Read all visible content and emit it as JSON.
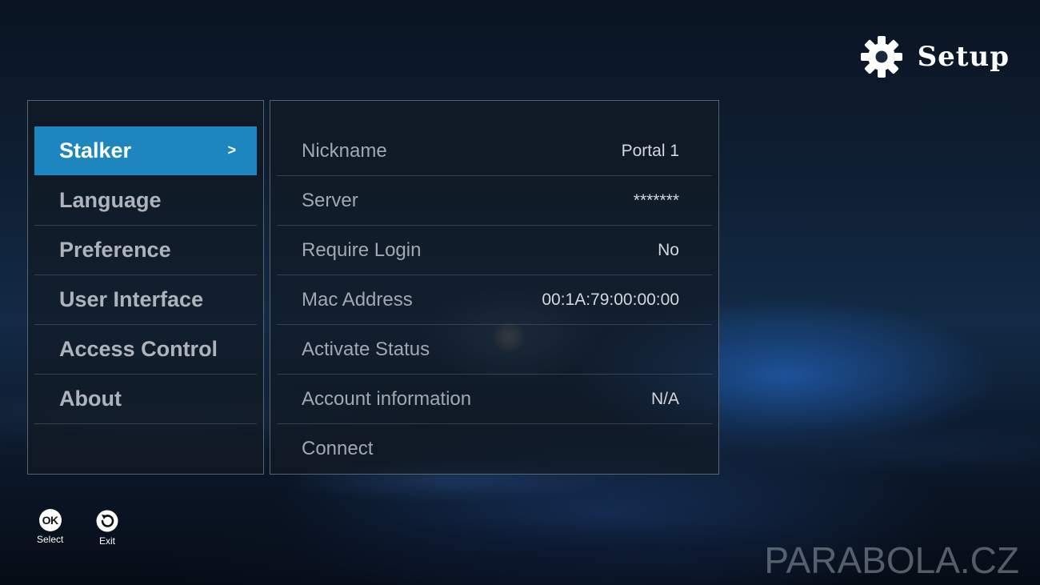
{
  "header": {
    "title": "Setup",
    "icon": "gear-icon"
  },
  "sidebar": {
    "items": [
      {
        "label": "Stalker",
        "active": true
      },
      {
        "label": "Language",
        "active": false
      },
      {
        "label": "Preference",
        "active": false
      },
      {
        "label": "User Interface",
        "active": false
      },
      {
        "label": "Access Control",
        "active": false
      },
      {
        "label": "About",
        "active": false
      }
    ],
    "active_chevron": ">"
  },
  "settings": {
    "rows": [
      {
        "label": "Nickname",
        "value": "Portal 1"
      },
      {
        "label": "Server",
        "value": "*******"
      },
      {
        "label": "Require Login",
        "value": "No"
      },
      {
        "label": "Mac Address",
        "value": "00:1A:79:00:00:00"
      },
      {
        "label": "Activate Status",
        "value": ""
      },
      {
        "label": "Account information",
        "value": "N/A"
      },
      {
        "label": "Connect",
        "value": ""
      }
    ]
  },
  "footer": {
    "select_key": "OK",
    "select_label": "Select",
    "exit_label": "Exit"
  },
  "watermark": "PARABOLA.CZ",
  "colors": {
    "accent": "#1e86bf",
    "text": "#ffffff"
  }
}
